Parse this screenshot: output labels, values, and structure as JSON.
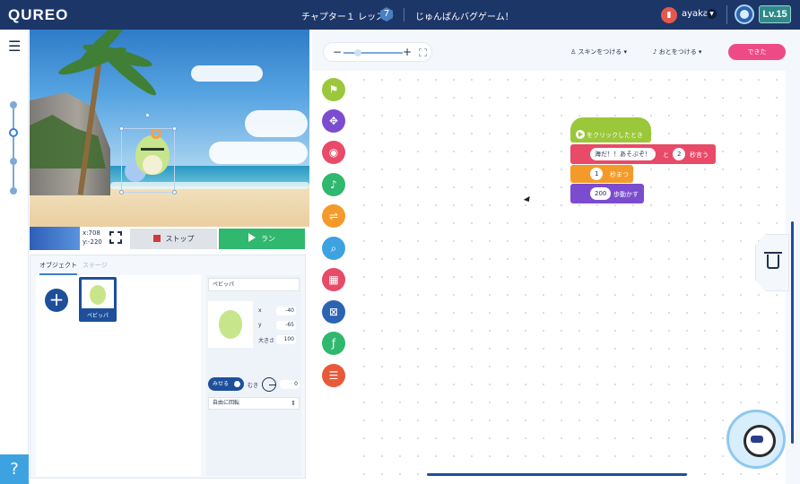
{
  "header": {
    "logo": "QUREO",
    "chapter": "チャプター１ レッスン",
    "lesson_number": "7",
    "lesson_title": "じゅんばんバグゲーム！",
    "user_name": "ayaka",
    "level": "Lv.15",
    "colors": {
      "bar": "#1d3668",
      "level_badge": "#2e8a8a"
    }
  },
  "sidebar": {
    "menu_icon": "hamburger-icon",
    "help_label": "?"
  },
  "stage": {
    "coord_x": "x:708",
    "coord_y": "y:-220",
    "stop_label": "ストップ",
    "run_label": "ラン"
  },
  "objects_panel": {
    "tabs": [
      "オブジェクト",
      "ステージ"
    ],
    "add_label": "+",
    "items": [
      {
        "name": "ペビッパ"
      }
    ],
    "properties": {
      "name": "ペビッパ",
      "x_label": "x",
      "x_value": "-40",
      "y_label": "y",
      "y_value": "-65",
      "size_label": "大きさ",
      "size_value": "100",
      "visible_label": "みせる",
      "direction_label": "むき",
      "direction_value": "0",
      "rotation_mode": "自由に回転"
    }
  },
  "editor": {
    "zoom_minus": "−",
    "zoom_plus": "+",
    "skin_label": "スキンをつける",
    "sound_label": "おとをつける",
    "done_label": "できた",
    "palette": [
      {
        "icon": "flag-icon",
        "color": "#9bc73a",
        "glyph": "⚑"
      },
      {
        "icon": "move-icon",
        "color": "#7b4ccf",
        "glyph": "✥"
      },
      {
        "icon": "look-icon",
        "color": "#e84a67",
        "glyph": "◉"
      },
      {
        "icon": "sound-icon",
        "color": "#2fb86e",
        "glyph": "♪"
      },
      {
        "icon": "control-icon",
        "color": "#f49a2a",
        "glyph": "⇌"
      },
      {
        "icon": "sensing-icon",
        "color": "#3da2e0",
        "glyph": "⌕"
      },
      {
        "icon": "variable-icon",
        "color": "#e84a67",
        "glyph": "▦"
      },
      {
        "icon": "math-icon",
        "color": "#2c63b3",
        "glyph": "⊠"
      },
      {
        "icon": "function-icon",
        "color": "#2fb86e",
        "glyph": "ƒ"
      },
      {
        "icon": "list-icon",
        "color": "#e8593a",
        "glyph": "☰"
      }
    ],
    "blocks": {
      "hat_label": "をクリックしたとき",
      "say_text": "海だ！！あそぶぞ！",
      "say_and": "と",
      "say_seconds": "2",
      "say_suffix": "秒言う",
      "wait_seconds": "1",
      "wait_suffix": "秒まつ",
      "move_steps": "200",
      "move_suffix": "歩動かす"
    }
  }
}
